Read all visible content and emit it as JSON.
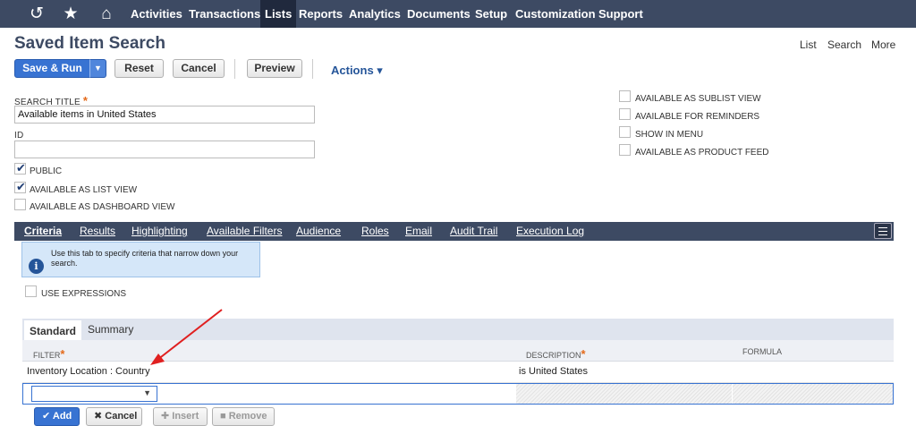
{
  "topnav": {
    "icons": [
      "history-icon",
      "star-icon",
      "home-icon"
    ],
    "items": [
      {
        "label": "Activities"
      },
      {
        "label": "Transactions"
      },
      {
        "label": "Lists"
      },
      {
        "label": "Reports"
      },
      {
        "label": "Analytics"
      },
      {
        "label": "Documents"
      },
      {
        "label": "Setup"
      },
      {
        "label": "Customization"
      },
      {
        "label": "Support"
      }
    ],
    "active": "Lists"
  },
  "page": {
    "title": "Saved Item Search",
    "links": [
      "List",
      "Search",
      "More"
    ]
  },
  "toolbar": {
    "save_run": "Save & Run",
    "reset": "Reset",
    "cancel": "Cancel",
    "preview": "Preview",
    "actions": "Actions ▾"
  },
  "form": {
    "search_title_label": "SEARCH TITLE",
    "search_title_value": "Available items in United States",
    "id_label": "ID",
    "id_value": "",
    "left_checkboxes": [
      {
        "label": "PUBLIC",
        "checked": true
      },
      {
        "label": "AVAILABLE AS LIST VIEW",
        "checked": true
      },
      {
        "label": "AVAILABLE AS DASHBOARD VIEW",
        "checked": false
      }
    ],
    "right_checkboxes": [
      {
        "label": "AVAILABLE AS SUBLIST VIEW",
        "checked": false
      },
      {
        "label": "AVAILABLE FOR REMINDERS",
        "checked": false
      },
      {
        "label": "SHOW IN MENU",
        "checked": false
      },
      {
        "label": "AVAILABLE AS PRODUCT FEED",
        "checked": false
      }
    ]
  },
  "tabs": [
    {
      "label": "Criteria",
      "active": true
    },
    {
      "label": "Results"
    },
    {
      "label": "Highlighting"
    },
    {
      "label": "Available Filters"
    },
    {
      "label": "Audience"
    },
    {
      "label": "Roles"
    },
    {
      "label": "Email"
    },
    {
      "label": "Audit Trail"
    },
    {
      "label": "Execution Log"
    }
  ],
  "tooltip": {
    "text": "Use this tab to specify criteria that narrow down your search."
  },
  "use_expressions": {
    "label": "USE EXPRESSIONS",
    "checked": false
  },
  "subtabs": [
    {
      "label": "Standard",
      "active": true
    },
    {
      "label": "Summary"
    }
  ],
  "grid": {
    "columns": [
      "FILTER",
      "DESCRIPTION",
      "FORMULA"
    ],
    "rows": [
      {
        "filter": "Inventory Location : Country",
        "description": "is United States",
        "formula": ""
      }
    ]
  },
  "row_buttons": {
    "add": "Add",
    "cancel": "Cancel",
    "insert": "Insert",
    "remove": "Remove"
  },
  "colors": {
    "nav_bg": "#3d4a63",
    "nav_active": "#20293d",
    "primary": "#3873d2",
    "required": "#e46a1a",
    "annotation_arrow": "#e02020"
  }
}
